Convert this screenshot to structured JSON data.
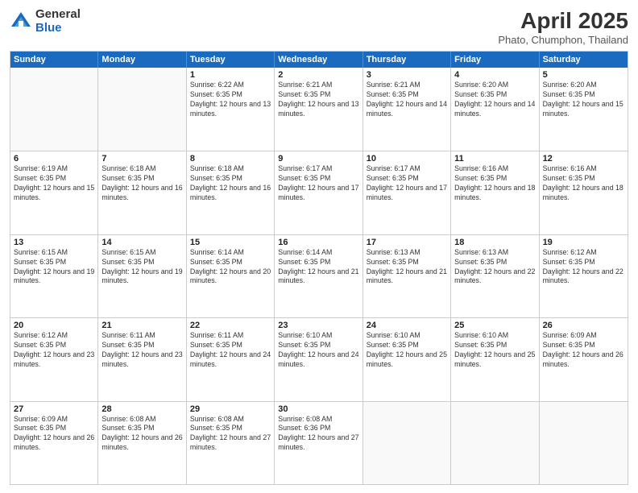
{
  "logo": {
    "general": "General",
    "blue": "Blue"
  },
  "title": "April 2025",
  "location": "Phato, Chumphon, Thailand",
  "header_days": [
    "Sunday",
    "Monday",
    "Tuesday",
    "Wednesday",
    "Thursday",
    "Friday",
    "Saturday"
  ],
  "weeks": [
    [
      {
        "day": "",
        "sunrise": "",
        "sunset": "",
        "daylight": ""
      },
      {
        "day": "",
        "sunrise": "",
        "sunset": "",
        "daylight": ""
      },
      {
        "day": "1",
        "sunrise": "Sunrise: 6:22 AM",
        "sunset": "Sunset: 6:35 PM",
        "daylight": "Daylight: 12 hours and 13 minutes."
      },
      {
        "day": "2",
        "sunrise": "Sunrise: 6:21 AM",
        "sunset": "Sunset: 6:35 PM",
        "daylight": "Daylight: 12 hours and 13 minutes."
      },
      {
        "day": "3",
        "sunrise": "Sunrise: 6:21 AM",
        "sunset": "Sunset: 6:35 PM",
        "daylight": "Daylight: 12 hours and 14 minutes."
      },
      {
        "day": "4",
        "sunrise": "Sunrise: 6:20 AM",
        "sunset": "Sunset: 6:35 PM",
        "daylight": "Daylight: 12 hours and 14 minutes."
      },
      {
        "day": "5",
        "sunrise": "Sunrise: 6:20 AM",
        "sunset": "Sunset: 6:35 PM",
        "daylight": "Daylight: 12 hours and 15 minutes."
      }
    ],
    [
      {
        "day": "6",
        "sunrise": "Sunrise: 6:19 AM",
        "sunset": "Sunset: 6:35 PM",
        "daylight": "Daylight: 12 hours and 15 minutes."
      },
      {
        "day": "7",
        "sunrise": "Sunrise: 6:18 AM",
        "sunset": "Sunset: 6:35 PM",
        "daylight": "Daylight: 12 hours and 16 minutes."
      },
      {
        "day": "8",
        "sunrise": "Sunrise: 6:18 AM",
        "sunset": "Sunset: 6:35 PM",
        "daylight": "Daylight: 12 hours and 16 minutes."
      },
      {
        "day": "9",
        "sunrise": "Sunrise: 6:17 AM",
        "sunset": "Sunset: 6:35 PM",
        "daylight": "Daylight: 12 hours and 17 minutes."
      },
      {
        "day": "10",
        "sunrise": "Sunrise: 6:17 AM",
        "sunset": "Sunset: 6:35 PM",
        "daylight": "Daylight: 12 hours and 17 minutes."
      },
      {
        "day": "11",
        "sunrise": "Sunrise: 6:16 AM",
        "sunset": "Sunset: 6:35 PM",
        "daylight": "Daylight: 12 hours and 18 minutes."
      },
      {
        "day": "12",
        "sunrise": "Sunrise: 6:16 AM",
        "sunset": "Sunset: 6:35 PM",
        "daylight": "Daylight: 12 hours and 18 minutes."
      }
    ],
    [
      {
        "day": "13",
        "sunrise": "Sunrise: 6:15 AM",
        "sunset": "Sunset: 6:35 PM",
        "daylight": "Daylight: 12 hours and 19 minutes."
      },
      {
        "day": "14",
        "sunrise": "Sunrise: 6:15 AM",
        "sunset": "Sunset: 6:35 PM",
        "daylight": "Daylight: 12 hours and 19 minutes."
      },
      {
        "day": "15",
        "sunrise": "Sunrise: 6:14 AM",
        "sunset": "Sunset: 6:35 PM",
        "daylight": "Daylight: 12 hours and 20 minutes."
      },
      {
        "day": "16",
        "sunrise": "Sunrise: 6:14 AM",
        "sunset": "Sunset: 6:35 PM",
        "daylight": "Daylight: 12 hours and 21 minutes."
      },
      {
        "day": "17",
        "sunrise": "Sunrise: 6:13 AM",
        "sunset": "Sunset: 6:35 PM",
        "daylight": "Daylight: 12 hours and 21 minutes."
      },
      {
        "day": "18",
        "sunrise": "Sunrise: 6:13 AM",
        "sunset": "Sunset: 6:35 PM",
        "daylight": "Daylight: 12 hours and 22 minutes."
      },
      {
        "day": "19",
        "sunrise": "Sunrise: 6:12 AM",
        "sunset": "Sunset: 6:35 PM",
        "daylight": "Daylight: 12 hours and 22 minutes."
      }
    ],
    [
      {
        "day": "20",
        "sunrise": "Sunrise: 6:12 AM",
        "sunset": "Sunset: 6:35 PM",
        "daylight": "Daylight: 12 hours and 23 minutes."
      },
      {
        "day": "21",
        "sunrise": "Sunrise: 6:11 AM",
        "sunset": "Sunset: 6:35 PM",
        "daylight": "Daylight: 12 hours and 23 minutes."
      },
      {
        "day": "22",
        "sunrise": "Sunrise: 6:11 AM",
        "sunset": "Sunset: 6:35 PM",
        "daylight": "Daylight: 12 hours and 24 minutes."
      },
      {
        "day": "23",
        "sunrise": "Sunrise: 6:10 AM",
        "sunset": "Sunset: 6:35 PM",
        "daylight": "Daylight: 12 hours and 24 minutes."
      },
      {
        "day": "24",
        "sunrise": "Sunrise: 6:10 AM",
        "sunset": "Sunset: 6:35 PM",
        "daylight": "Daylight: 12 hours and 25 minutes."
      },
      {
        "day": "25",
        "sunrise": "Sunrise: 6:10 AM",
        "sunset": "Sunset: 6:35 PM",
        "daylight": "Daylight: 12 hours and 25 minutes."
      },
      {
        "day": "26",
        "sunrise": "Sunrise: 6:09 AM",
        "sunset": "Sunset: 6:35 PM",
        "daylight": "Daylight: 12 hours and 26 minutes."
      }
    ],
    [
      {
        "day": "27",
        "sunrise": "Sunrise: 6:09 AM",
        "sunset": "Sunset: 6:35 PM",
        "daylight": "Daylight: 12 hours and 26 minutes."
      },
      {
        "day": "28",
        "sunrise": "Sunrise: 6:08 AM",
        "sunset": "Sunset: 6:35 PM",
        "daylight": "Daylight: 12 hours and 26 minutes."
      },
      {
        "day": "29",
        "sunrise": "Sunrise: 6:08 AM",
        "sunset": "Sunset: 6:35 PM",
        "daylight": "Daylight: 12 hours and 27 minutes."
      },
      {
        "day": "30",
        "sunrise": "Sunrise: 6:08 AM",
        "sunset": "Sunset: 6:36 PM",
        "daylight": "Daylight: 12 hours and 27 minutes."
      },
      {
        "day": "",
        "sunrise": "",
        "sunset": "",
        "daylight": ""
      },
      {
        "day": "",
        "sunrise": "",
        "sunset": "",
        "daylight": ""
      },
      {
        "day": "",
        "sunrise": "",
        "sunset": "",
        "daylight": ""
      }
    ]
  ]
}
